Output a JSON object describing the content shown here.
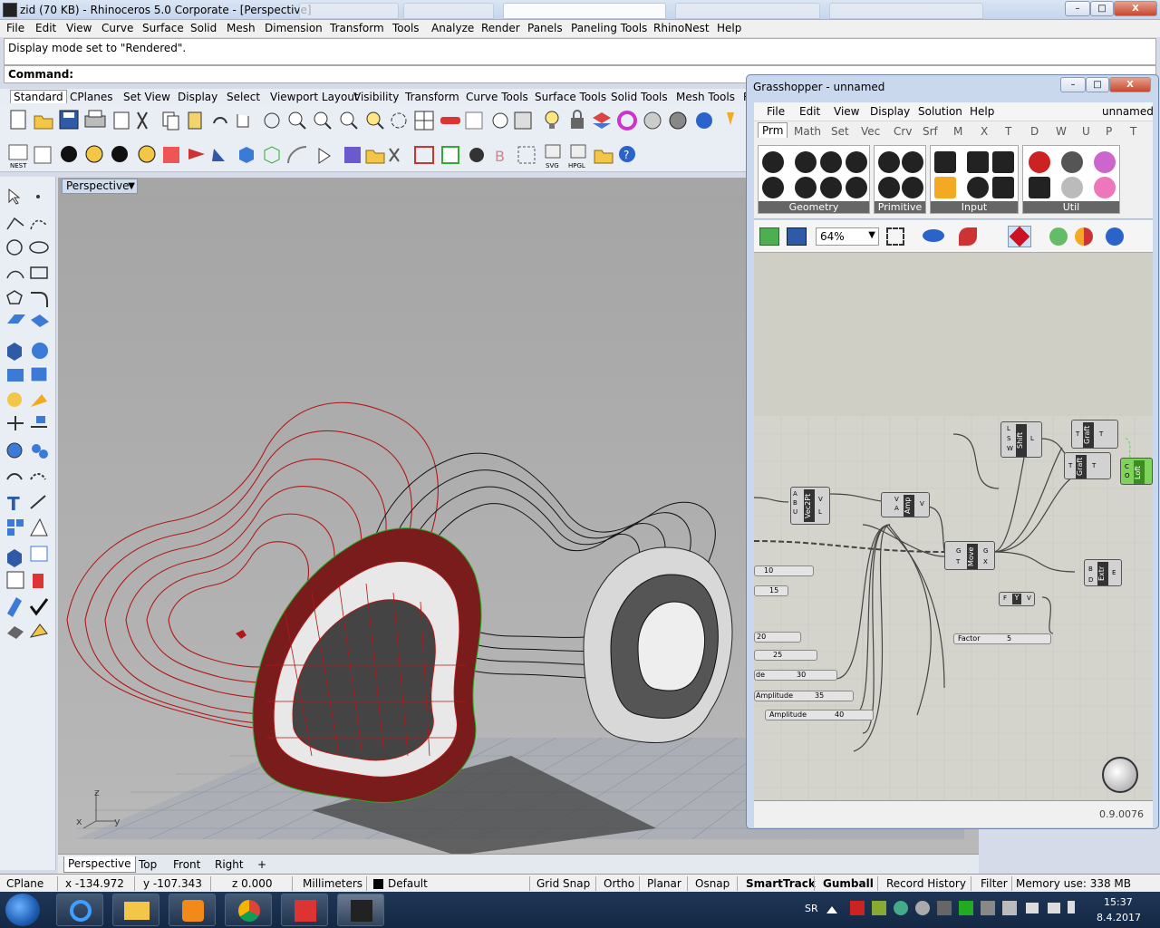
{
  "window": {
    "title": "zid (70 KB) - Rhinoceros  5.0 Corporate - [Perspective]",
    "controls": {
      "minimize": "–",
      "maximize": "□",
      "close": "X"
    }
  },
  "menu": [
    "File",
    "Edit",
    "View",
    "Curve",
    "Surface",
    "Solid",
    "Mesh",
    "Dimension",
    "Transform",
    "Tools",
    "Analyze",
    "Render",
    "Panels",
    "Paneling Tools",
    "RhinoNest",
    "Help"
  ],
  "command": {
    "history": "Display mode set to \"Rendered\".",
    "prompt": "Command:"
  },
  "toolbar_tabs": [
    "Standard",
    "CPlanes",
    "Set View",
    "Display",
    "Select",
    "Viewport Layout",
    "Visibility",
    "Transform",
    "Curve Tools",
    "Surface Tools",
    "Solid Tools",
    "Mesh Tools",
    "R"
  ],
  "toolbar2_labels": {
    "nest": "NEST",
    "svg": "SVG",
    "hpgl": "HPGL"
  },
  "viewport": {
    "name": "Perspective",
    "tabs": [
      "Perspective",
      "Top",
      "Front",
      "Right"
    ],
    "add_tab": "+",
    "axes": {
      "x": "x",
      "y": "y",
      "z": "z"
    }
  },
  "statusbar": {
    "cplane": "CPlane",
    "x": "x -134.972",
    "y": "y -107.343",
    "z": "z 0.000",
    "units": "Millimeters",
    "layer": "Default",
    "grid_snap": "Grid Snap",
    "ortho": "Ortho",
    "planar": "Planar",
    "osnap": "Osnap",
    "smarttrack": "SmartTrack",
    "gumball": "Gumball",
    "record_history": "Record History",
    "filter": "Filter",
    "memory": "Memory use: 338 MB"
  },
  "taskbar": {
    "lang": "SR",
    "time": "15:37",
    "date": "8.4.2017"
  },
  "grasshopper": {
    "title": "Grasshopper - unnamed",
    "doc_name": "unnamed",
    "menu": [
      "File",
      "Edit",
      "View",
      "Display",
      "Solution",
      "Help"
    ],
    "tabs": [
      "Prm",
      "Math",
      "Set",
      "Vec",
      "Crv",
      "Srf",
      "M",
      "X",
      "T",
      "D",
      "W",
      "U",
      "P",
      "T"
    ],
    "groups": [
      "Geometry",
      "Primitive",
      "Input",
      "Util"
    ],
    "zoom": "64%",
    "version": "0.9.0076",
    "components": {
      "vec2pt": {
        "name": "Vec2Pt",
        "inputs": [
          "A",
          "B",
          "U"
        ],
        "outputs": [
          "V",
          "L"
        ]
      },
      "amp": {
        "name": "Amp",
        "inputs": [
          "V",
          "A"
        ],
        "outputs": [
          "V"
        ]
      },
      "shift": {
        "name": "Shift",
        "inputs": [
          "L",
          "S",
          "W"
        ],
        "outputs": [
          "L"
        ]
      },
      "graft1": {
        "name": "Graft",
        "inputs": [
          "T"
        ],
        "outputs": [
          "T"
        ]
      },
      "graft2": {
        "name": "Graft",
        "inputs": [
          "T"
        ],
        "outputs": [
          "T"
        ]
      },
      "loft": {
        "name": "Loft",
        "inputs": [
          "C",
          "O"
        ]
      },
      "move": {
        "name": "Move",
        "inputs": [
          "G",
          "T"
        ],
        "outputs": [
          "G",
          "X"
        ]
      },
      "extr": {
        "name": "Extr",
        "inputs": [
          "B",
          "D"
        ],
        "outputs": [
          "E"
        ]
      },
      "y": {
        "name": "Y",
        "inputs": [
          "F"
        ],
        "outputs": [
          "V"
        ]
      }
    },
    "sliders": [
      {
        "label": "",
        "value": "10"
      },
      {
        "label": "",
        "value": "15"
      },
      {
        "label": "",
        "value": "20"
      },
      {
        "label": "",
        "value": "25"
      },
      {
        "label": "de",
        "value": "30"
      },
      {
        "label": "Amplitude",
        "value": "35"
      },
      {
        "label": "Amplitude",
        "value": "40"
      },
      {
        "label": "Factor",
        "value": "5"
      }
    ]
  }
}
